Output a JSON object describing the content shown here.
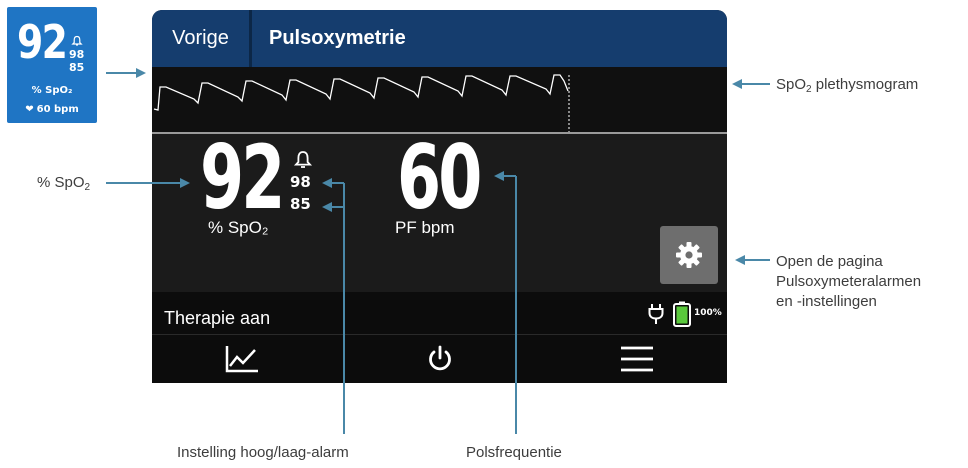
{
  "mini_widget": {
    "spo2": "92",
    "alarm_high": "98",
    "alarm_low": "85",
    "label": "% SpO₂",
    "pulse": "60 bpm",
    "bg_color": "#1f75c4"
  },
  "header": {
    "back_label": "Vorige",
    "title": "Pulsoxymetrie"
  },
  "readings": {
    "spo2_value": "92",
    "spo2_label": "% SpO₂",
    "alarm_high": "98",
    "alarm_low": "85",
    "pf_value": "60",
    "pf_label": "PF bpm"
  },
  "status": {
    "text": "Therapie aan",
    "battery_percent": "100%",
    "power_icon": "plug-icon",
    "battery_icon": "battery-icon"
  },
  "nav": [
    {
      "icon": "trend-chart-icon"
    },
    {
      "icon": "power-icon"
    },
    {
      "icon": "menu-icon"
    }
  ],
  "callouts": {
    "plethysmogram_pre": "SpO",
    "plethysmogram_sub": "2",
    "plethysmogram_post": " plethysmogram",
    "spo2_pre": "% SpO",
    "spo2_sub": "2",
    "settings_line1": "Open de pagina",
    "settings_line2": "Pulsoxymeteralarmen",
    "settings_line3": "en -instellingen",
    "alarm_setting": "Instelling hoog/laag-alarm",
    "pulse_rate": "Polsfrequentie"
  },
  "colors": {
    "header_bg": "#153d6e",
    "screen_bg": "#141414",
    "arrow": "#4a88a8",
    "battery_fill": "#5ac83c"
  }
}
